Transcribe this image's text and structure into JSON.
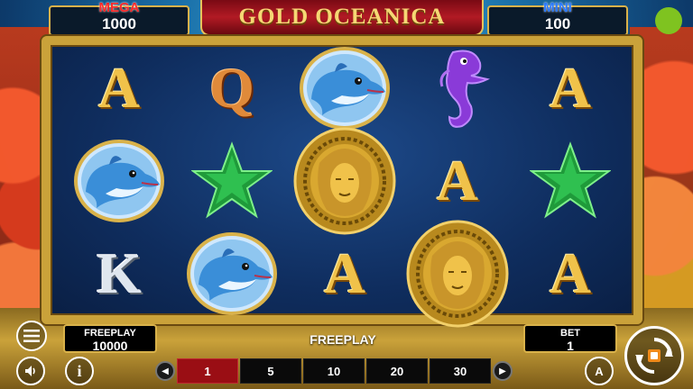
{
  "title": "GOLD OCEANICA",
  "jackpots": {
    "mega": {
      "label": "MEGA",
      "value": "1000"
    },
    "mini": {
      "label": "MINI",
      "value": "100"
    }
  },
  "reels": [
    [
      {
        "kind": "letter",
        "text": "A",
        "style": "gold",
        "name": "symbol-a"
      },
      {
        "kind": "dolphin",
        "name": "symbol-dolphin"
      },
      {
        "kind": "letter",
        "text": "K",
        "style": "silver",
        "name": "symbol-k"
      }
    ],
    [
      {
        "kind": "letter",
        "text": "Q",
        "style": "copper",
        "name": "symbol-q"
      },
      {
        "kind": "starfish",
        "name": "symbol-starfish"
      },
      {
        "kind": "dolphin",
        "name": "symbol-dolphin"
      }
    ],
    [
      {
        "kind": "dolphin",
        "name": "symbol-dolphin"
      },
      {
        "kind": "medallion",
        "name": "symbol-gold-medallion"
      },
      {
        "kind": "letter",
        "text": "A",
        "style": "gold",
        "name": "symbol-a"
      }
    ],
    [
      {
        "kind": "seahorse",
        "name": "symbol-seahorse"
      },
      {
        "kind": "letter",
        "text": "A",
        "style": "gold",
        "name": "symbol-a"
      },
      {
        "kind": "medallion",
        "name": "symbol-gold-medallion"
      }
    ],
    [
      {
        "kind": "letter",
        "text": "A",
        "style": "gold",
        "name": "symbol-a"
      },
      {
        "kind": "starfish",
        "name": "symbol-starfish"
      },
      {
        "kind": "letter",
        "text": "A",
        "style": "gold",
        "name": "symbol-a"
      }
    ]
  ],
  "freeplay_panel": {
    "label": "FREEPLAY",
    "value": "10000"
  },
  "center_text": "FREEPLAY",
  "bet_panel": {
    "label": "BET",
    "value": "1"
  },
  "lines": {
    "options": [
      "1",
      "5",
      "10",
      "20",
      "30"
    ],
    "selected": "1"
  },
  "buttons": {
    "info": "i",
    "auto": "A"
  },
  "colors": {
    "active_line": "#9a0e14",
    "frame_gold": "#caa23a",
    "mega_red": "#ff2a2a",
    "mini_blue": "#2a7aff",
    "status_dot": "#7fc320"
  }
}
